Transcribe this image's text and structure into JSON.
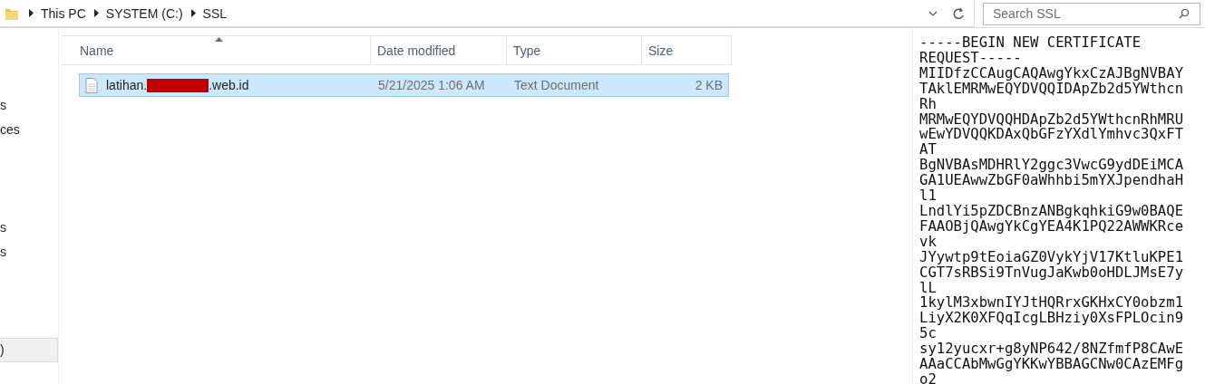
{
  "address_bar": {
    "crumbs": [
      "This PC",
      "SYSTEM (C:)",
      "SSL"
    ]
  },
  "search": {
    "placeholder": "Search SSL"
  },
  "sidebar": {
    "groups": [
      [
        {
          "label": "s",
          "selected": false
        },
        {
          "label": "ces",
          "selected": false
        }
      ],
      [
        {
          "label": "s",
          "selected": false
        },
        {
          "label": "s",
          "selected": false
        }
      ],
      [
        {
          "label": ")",
          "selected": true
        }
      ]
    ]
  },
  "table": {
    "columns": [
      {
        "label": "Name",
        "sorted": true
      },
      {
        "label": "Date modified",
        "sorted": false
      },
      {
        "label": "Type",
        "sorted": false
      },
      {
        "label": "Size",
        "sorted": false
      }
    ],
    "rows": [
      {
        "name_before": "latihan.",
        "name_redacted": true,
        "name_after": ".web.id",
        "date": "5/21/2025 1:06 AM",
        "type": "Text Document",
        "size": "2 KB",
        "selected": true
      }
    ]
  },
  "preview": {
    "lines": [
      "-----BEGIN NEW CERTIFICATE",
      "REQUEST-----",
      "MIIDfzCCAugCAQAwgYkxCzAJBgNVBAY",
      "TAklEMRMwEQYDVQQIDApZb2d5YWthcn",
      "Rh",
      "MRMwEQYDVQQHDApZb2d5YWthcnRhMRU",
      "wEwYDVQQKDAxQbGFzYXdlYmhvc3QxFT",
      "AT",
      "BgNVBAsMDHRlY2ggc3VwcG9ydDEiMCA",
      "GA1UEAwwZbGF0aWhhbi5mYXJpendhaH",
      "l1",
      "LndlYi5pZDCBnzANBgkqhkiG9w0BAQE",
      "FAAOBjQAwgYkCgYEA4K1PQ22AWWKRce",
      "vk",
      "JYywtp9tEoiaGZ0VykYjV17KtluKPE1",
      "CGT7sRBSi9TnVugJaKwb0oHDLJMsE7y",
      "lL",
      "1kylM3xbwnIYJtHQRrxGKHxCY0obzm1",
      "LiyX2K0XFQqIcgLBHziy0XsFPLOcin9",
      "5c",
      "sy12yucxr+g8yNP642/8NZfmfP8CAwE",
      "AAaCCAbMwGgYKKwYBBAGCNw0CAzEMFg",
      "o2"
    ]
  }
}
